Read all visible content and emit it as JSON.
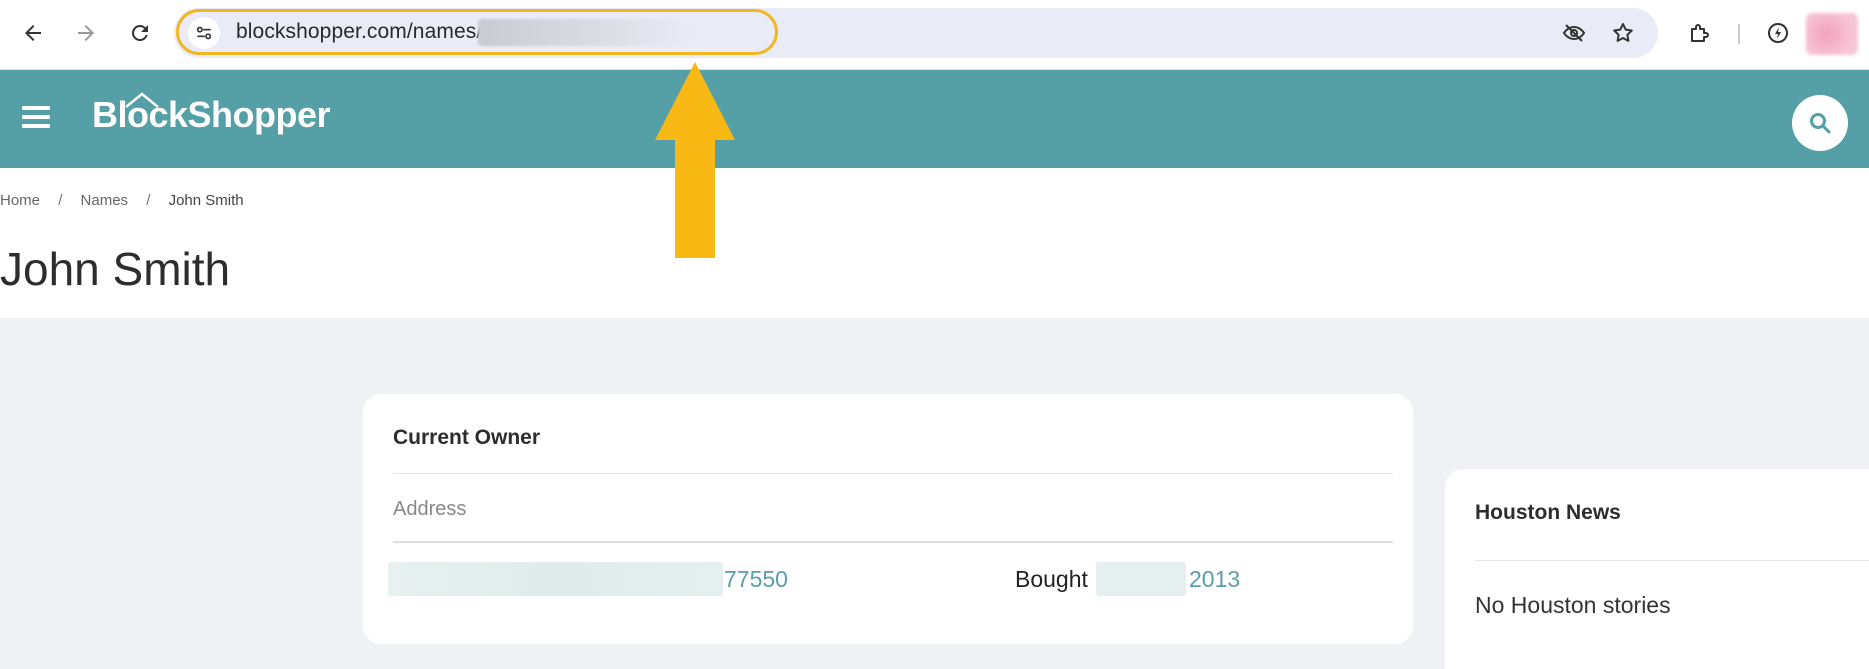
{
  "browser": {
    "url_visible": "blockshopper.com/names/",
    "icons": [
      "back-arrow-icon",
      "forward-arrow-icon",
      "reload-icon",
      "site-settings-icon",
      "eye-off-icon",
      "bookmark-star-icon",
      "extensions-icon",
      "performance-icon",
      "profile-avatar"
    ]
  },
  "site": {
    "logo_text": "BlockShopper",
    "brand_color": "#559fa7",
    "link_color": "#5a9ea7"
  },
  "breadcrumb": {
    "home": "Home",
    "names": "Names",
    "current": "John Smith",
    "separator": "/"
  },
  "page": {
    "title": "John Smith"
  },
  "owner_card": {
    "title": "Current Owner",
    "address_header": "Address",
    "zip": "77550",
    "bought_label": "Bought",
    "year": "2013"
  },
  "news_card": {
    "title": "Houston News",
    "empty_text": "No Houston stories"
  },
  "annotation": {
    "arrow_color": "#f9b914"
  }
}
